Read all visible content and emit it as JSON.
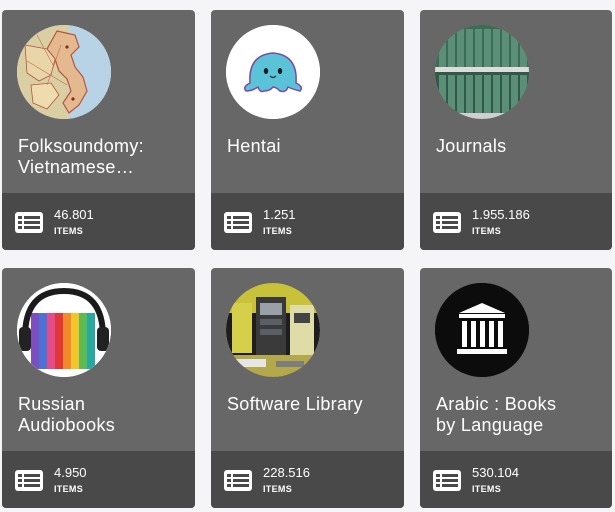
{
  "collections": [
    {
      "title": "Folksoundomy:\nVietnamese…",
      "count": "46.801",
      "count_label": "ITEMS",
      "icon": "vietnam-map-icon"
    },
    {
      "title": "Hentai",
      "count": "1.251",
      "count_label": "ITEMS",
      "icon": "octopus-icon"
    },
    {
      "title": "Journals",
      "count": "1.955.186",
      "count_label": "ITEMS",
      "icon": "bookshelf-icon"
    },
    {
      "title": "Russian\nAudiobooks",
      "count": "4.950",
      "count_label": "ITEMS",
      "icon": "headphones-books-icon"
    },
    {
      "title": "Software Library",
      "count": "228.516",
      "count_label": "ITEMS",
      "icon": "computer-room-icon"
    },
    {
      "title": "Arabic : Books\nby Language",
      "count": "530.104",
      "count_label": "ITEMS",
      "icon": "archive-building-icon"
    }
  ],
  "colors": {
    "card_bg": "#676767",
    "card_footer_bg": "#494949",
    "page_bg": "#f5f5f7",
    "text": "#ffffff"
  }
}
